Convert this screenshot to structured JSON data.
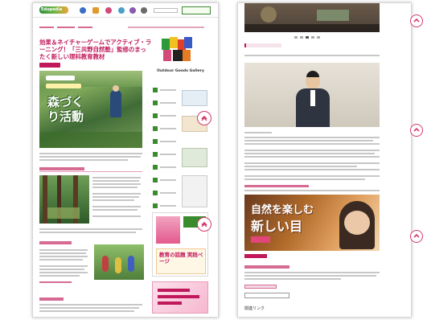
{
  "panel_left": {
    "site_logo": "Edupedia",
    "nav_items": [
      "nav-1",
      "nav-2",
      "nav-3",
      "nav-4",
      "nav-5",
      "nav-6"
    ],
    "breadcrumb": "",
    "category_tag": "",
    "article_title": "効果＆ネイチャーゲームでアクティブ・ラーニング！「三共野自然塾」監修のまったく新しい理科教育教材",
    "hero_overlay_small": "",
    "hero_overlay_large": "森づくり活動",
    "section_heading": "",
    "brand_name": "Outdoor Goods Gallery",
    "ad_label": "",
    "ad_text": "教育の話題 実践ページ"
  },
  "panel_right": {
    "caption_heading": "",
    "subheading": "",
    "person_caption": "",
    "event_heading": "",
    "promo_text_line1": "自然を楽しむ",
    "promo_text_line2": "新しい目",
    "promo_badge": "",
    "footer_heading": "",
    "footer_btn1": "",
    "footer_btn2": "",
    "footer_label": "関連リンク"
  },
  "colors": {
    "accent": "#c0185a",
    "green": "#3a8a2e",
    "scroll_ring": "#d33a6a"
  },
  "icons": {
    "scroll_button": "chevron-up-in-circle"
  }
}
